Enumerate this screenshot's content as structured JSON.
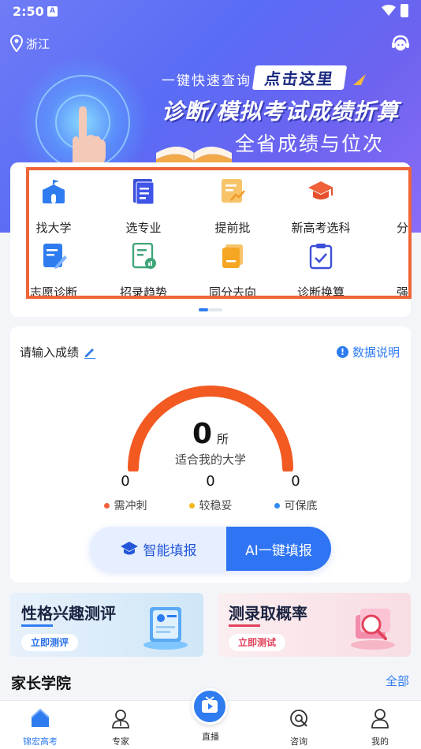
{
  "status_bar": {
    "time": "2:50",
    "notif_badge": "A"
  },
  "header": {
    "location": "浙江"
  },
  "banner": {
    "tagline": "一键快速查询",
    "cta": "点击这里",
    "headline": "诊断/模拟考试成绩折算",
    "subline": "全省成绩与位次"
  },
  "quick_menu": {
    "row1": [
      "找大学",
      "选专业",
      "提前批",
      "新高考选科",
      "分数"
    ],
    "row2": [
      "志愿诊断",
      "招录趋势",
      "同分去向",
      "诊断换算",
      "强基"
    ],
    "accent": "#2f7cf0",
    "highlight_color": "#f06538"
  },
  "score": {
    "prompt": "请输入成绩",
    "data_explain": "数据说明",
    "count": "0",
    "unit": "所",
    "caption": "适合我的大学",
    "stats": [
      {
        "value": "0",
        "label": "需冲刺",
        "color": "#f0603a"
      },
      {
        "value": "0",
        "label": "较稳妥",
        "color": "#f5b820"
      },
      {
        "value": "0",
        "label": "可保底",
        "color": "#2f8cf0"
      }
    ],
    "btn_smart": "智能填报",
    "btn_ai": "AI一键填报",
    "gauge_color": "#f25a22"
  },
  "promos": [
    {
      "title": "性格兴趣测评",
      "button": "立即测评"
    },
    {
      "title": "测录取概率",
      "button": "立即测试"
    }
  ],
  "parents": {
    "title": "家长学院",
    "more": "全部"
  },
  "bottom_nav": [
    {
      "label": "锦宏高考",
      "icon": "home-icon"
    },
    {
      "label": "专家",
      "icon": "expert-icon"
    },
    {
      "label": "直播",
      "icon": "live-icon"
    },
    {
      "label": "咨询",
      "icon": "consult-icon"
    },
    {
      "label": "我的",
      "icon": "profile-icon"
    }
  ]
}
